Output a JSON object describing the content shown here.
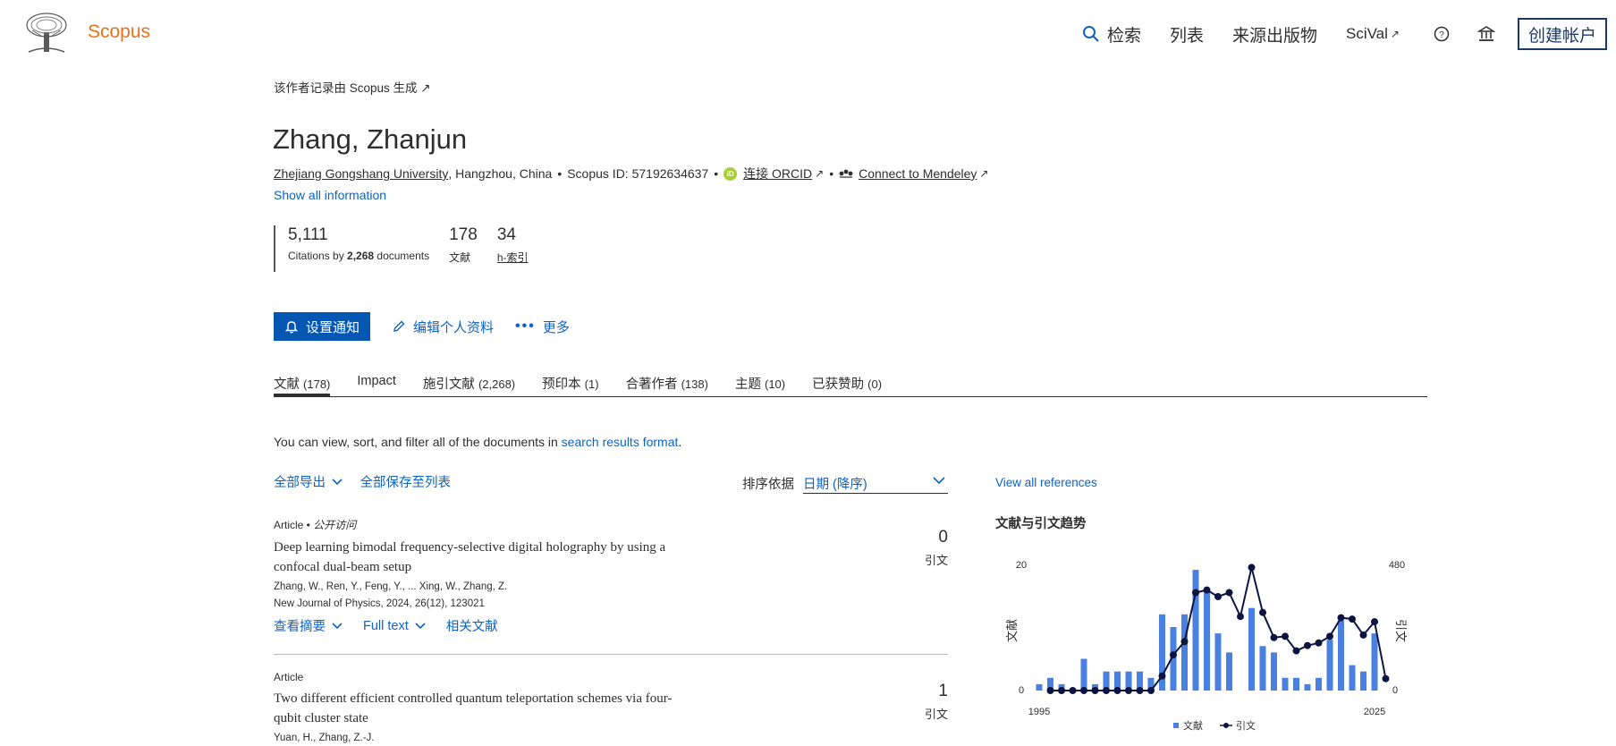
{
  "header": {
    "brand": "Scopus",
    "nav": {
      "search": "检索",
      "lists": "列表",
      "sources": "来源出版物",
      "scival": "SciVal",
      "scival_ext": "↗"
    },
    "help_icon": "help-icon",
    "institution_icon": "institution-icon",
    "create_account": "创建帐户"
  },
  "profile": {
    "generated_note": "该作者记录由 Scopus 生成 ↗",
    "name": "Zhang, Zhanjun",
    "affiliation": "Zhejiang Gongshang University",
    "location": ", Hangzhou, China",
    "bullet": "•",
    "scopus_id": "Scopus ID: 57192634637",
    "orcid_icon_label": "iD",
    "orcid_link": "连接 ORCID",
    "mendeley_link": "Connect to Mendeley",
    "ext_arrow": "↗",
    "show_all": "Show all information"
  },
  "metrics": {
    "citations": "5,111",
    "citations_label_pre": "Citations by ",
    "citations_docs": "2,268",
    "citations_label_post": " documents",
    "documents": "178",
    "documents_label": "文献",
    "h_index": "34",
    "h_index_label": "h-索引"
  },
  "actions": {
    "alert": "设置通知",
    "edit": "编辑个人资料",
    "more_dots": "•••",
    "more": "更多"
  },
  "tabs": [
    {
      "label": "文献 ",
      "count": "(178)"
    },
    {
      "label": "Impact",
      "count": ""
    },
    {
      "label": "施引文献 ",
      "count": "(2,268)"
    },
    {
      "label": "预印本 ",
      "count": "(1)"
    },
    {
      "label": "合著作者 ",
      "count": "(138)"
    },
    {
      "label": "主题 ",
      "count": "(10)"
    },
    {
      "label": "已获赞助 ",
      "count": "(0)"
    }
  ],
  "list": {
    "view_text": "You can view, sort, and filter all of the documents in ",
    "view_link": "search results format",
    "view_end": ".",
    "export_all": "全部导出",
    "save_all": "全部保存至列表",
    "sort_label": "排序依据",
    "sort_value": "日期 (降序)"
  },
  "documents": [
    {
      "type": "Article",
      "open_access": "公开访问",
      "title": "Deep learning bimodal frequency-selective digital holography by using a confocal dual-beam setup",
      "authors": "Zhang, W., Ren, Y., Feng, Y., ... Xing, W., Zhang, Z.",
      "source": "New Journal of Physics, 2024, 26(12), 123021",
      "abstract": "查看摘要",
      "fulltext": "Full text",
      "related": "相关文献",
      "citations": "0",
      "citations_label": "引文"
    },
    {
      "type": "Article",
      "title": "Two different efficient controlled quantum teleportation schemes via four-qubit cluster state",
      "authors": "Yuan, H., Zhang, Z.-J.",
      "citations": "1",
      "citations_label": "引文"
    }
  ],
  "sidebar": {
    "view_refs": "View all references",
    "trend_title": "文献与引文趋势"
  },
  "chart_data": {
    "type": "bar",
    "x_range": [
      1995,
      2025
    ],
    "x_tick_labels": [
      "1995",
      "2025"
    ],
    "left_axis": {
      "label": "文献",
      "ticks": [
        "0",
        "20"
      ],
      "range": [
        0,
        20
      ]
    },
    "right_axis": {
      "label": "引文",
      "ticks": [
        "0",
        "480"
      ],
      "range": [
        0,
        480
      ]
    },
    "legend": [
      "文献",
      "引文"
    ],
    "legend_placement": "bottom",
    "colors": {
      "documents": "#4a80e0",
      "citations": "#0c1541"
    },
    "series": [
      {
        "name": "文献",
        "kind": "bar",
        "points": [
          [
            1995,
            1
          ],
          [
            1996,
            2
          ],
          [
            1997,
            1
          ],
          [
            1999,
            5
          ],
          [
            2000,
            1
          ],
          [
            2001,
            3
          ],
          [
            2002,
            3
          ],
          [
            2003,
            3
          ],
          [
            2004,
            3
          ],
          [
            2005,
            2
          ],
          [
            2006,
            12
          ],
          [
            2007,
            10
          ],
          [
            2008,
            12
          ],
          [
            2009,
            19
          ],
          [
            2010,
            16
          ],
          [
            2011,
            9
          ],
          [
            2012,
            6
          ],
          [
            2014,
            13
          ],
          [
            2015,
            7
          ],
          [
            2016,
            6
          ],
          [
            2017,
            2
          ],
          [
            2018,
            2
          ],
          [
            2019,
            1
          ],
          [
            2020,
            2
          ],
          [
            2021,
            8
          ],
          [
            2022,
            11
          ],
          [
            2023,
            4
          ],
          [
            2024,
            3
          ],
          [
            2025,
            9
          ]
        ]
      },
      {
        "name": "引文",
        "kind": "line",
        "points": [
          [
            1996,
            0
          ],
          [
            1997,
            0
          ],
          [
            1998,
            0
          ],
          [
            1999,
            0
          ],
          [
            2000,
            0
          ],
          [
            2001,
            0
          ],
          [
            2002,
            0
          ],
          [
            2003,
            0
          ],
          [
            2004,
            0
          ],
          [
            2005,
            0
          ],
          [
            2006,
            55
          ],
          [
            2007,
            135
          ],
          [
            2008,
            185
          ],
          [
            2009,
            370
          ],
          [
            2010,
            380
          ],
          [
            2011,
            355
          ],
          [
            2012,
            370
          ],
          [
            2013,
            280
          ],
          [
            2014,
            465
          ],
          [
            2015,
            295
          ],
          [
            2016,
            200
          ],
          [
            2017,
            205
          ],
          [
            2018,
            150
          ],
          [
            2019,
            170
          ],
          [
            2020,
            180
          ],
          [
            2021,
            205
          ],
          [
            2022,
            275
          ],
          [
            2023,
            270
          ],
          [
            2024,
            210
          ],
          [
            2025,
            260
          ],
          [
            2026,
            45
          ]
        ]
      }
    ]
  }
}
